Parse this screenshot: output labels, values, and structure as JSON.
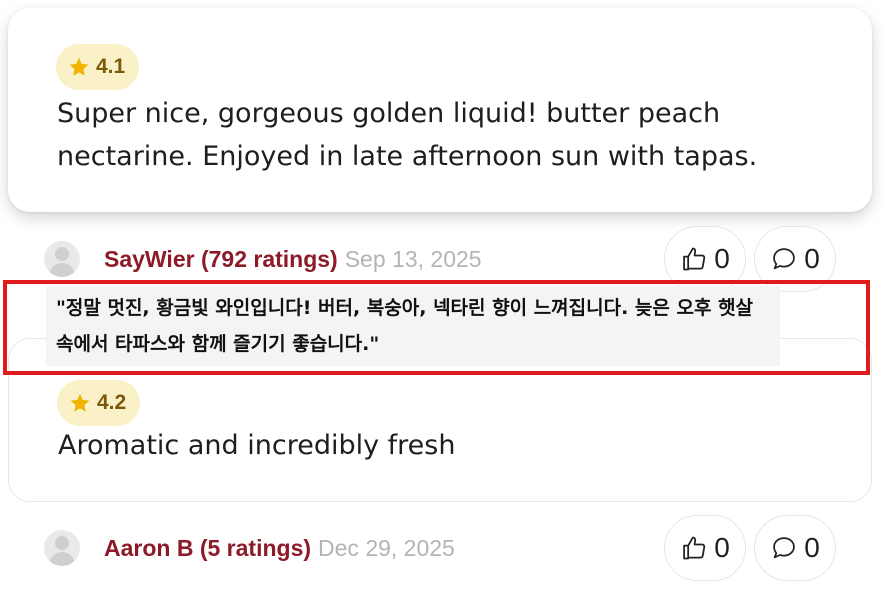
{
  "reviews": [
    {
      "rating": "4.1",
      "text": "Super nice, gorgeous golden liquid! butter peach nectarine. Enjoyed in late afternoon sun with tapas.",
      "user": "SayWier (792 ratings)",
      "date": "Sep 13, 2025",
      "likes": "0",
      "comments": "0",
      "translation": "\"정말 멋진, 황금빛 와인입니다! 버터, 복숭아, 넥타린 향이 느껴집니다. 늦은 오후 햇살 속에서 타파스와 함께 즐기기 좋습니다.\""
    },
    {
      "rating": "4.2",
      "text": "Aromatic and incredibly fresh",
      "user": "Aaron B (5 ratings)",
      "date": "Dec 29, 2025",
      "likes": "0",
      "comments": "0"
    }
  ],
  "colors": {
    "username": "#8c1a28",
    "badge_bg": "#fbf1c8",
    "star": "#f0b400",
    "highlight_border": "#e01b1b"
  },
  "icons": {
    "rating": "star-icon",
    "like": "thumbs-up-icon",
    "comment": "speech-bubble-icon",
    "avatar": "user-avatar-placeholder"
  }
}
